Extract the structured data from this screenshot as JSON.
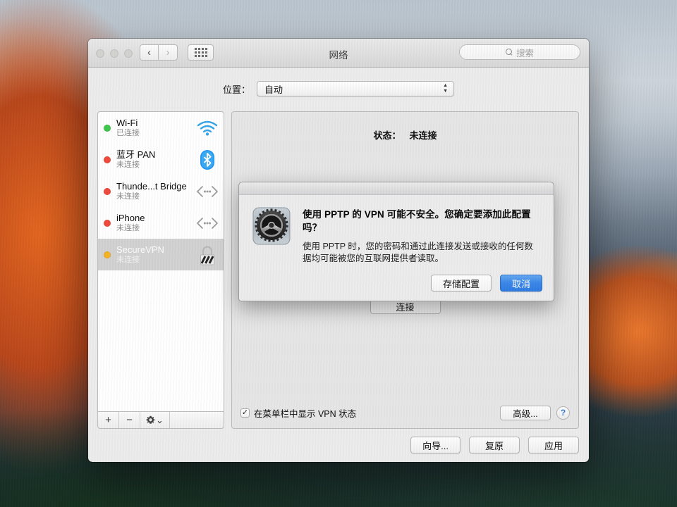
{
  "window": {
    "title": "网络",
    "traffic_lights": [
      "close",
      "minimize",
      "zoom"
    ],
    "nav_back": "‹",
    "nav_forward": "›",
    "grid_icon": "grid-icon",
    "search_placeholder": "搜索"
  },
  "location": {
    "label": "位置：",
    "selected": "自动",
    "options": [
      "自动"
    ]
  },
  "sidebar": {
    "services": [
      {
        "name": "Wi-Fi",
        "status": "已连接",
        "dot": "#3cc84b",
        "icon": "wifi-icon",
        "selected": false
      },
      {
        "name": "蓝牙 PAN",
        "status": "未连接",
        "dot": "#f04a3c",
        "icon": "bluetooth-icon",
        "selected": false
      },
      {
        "name": "Thunde...t Bridge",
        "status": "未连接",
        "dot": "#f04a3c",
        "icon": "bridge-icon",
        "selected": false
      },
      {
        "name": "iPhone",
        "status": "未连接",
        "dot": "#f04a3c",
        "icon": "bridge-icon",
        "selected": false
      },
      {
        "name": "SecureVPN",
        "status": "未连接",
        "dot": "#f5b game",
        "icon": "lock-icon",
        "selected": true
      }
    ],
    "toolbar": {
      "add": "+",
      "remove": "−",
      "gear": "gear-icon",
      "gear_chevron": "⌄"
    }
  },
  "detail": {
    "status_label": "状态：",
    "status_value": "未连接",
    "connect_button": "连接",
    "show_vpn_status_label": "在菜单栏中显示 VPN 状态",
    "show_vpn_status_checked": true,
    "checkmark": "✓",
    "advanced_button": "高级...",
    "help_button": "?"
  },
  "footer": {
    "assistant_button": "向导...",
    "revert_button": "复原",
    "apply_button": "应用"
  },
  "sheet": {
    "title": "使用 PPTP 的 VPN 可能不安全。您确定要添加此配置吗？",
    "message": "使用 PPTP 时，您的密码和通过此连接发送或接收的任何数据均可能被您的互联网提供者读取。",
    "icon": "system-preferences-gear-icon",
    "save_button": "存储配置",
    "cancel_button": "取消",
    "accent_color": "#3a86e8"
  }
}
